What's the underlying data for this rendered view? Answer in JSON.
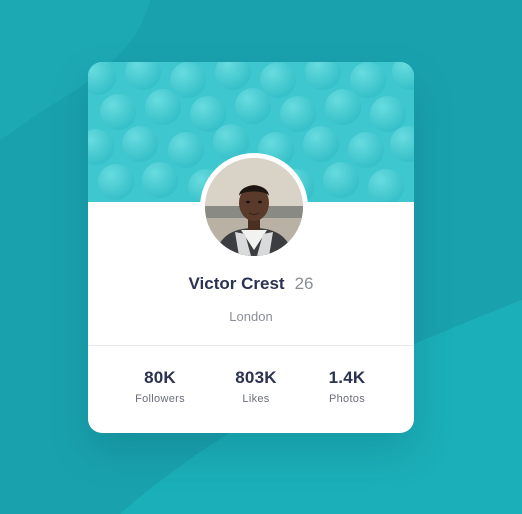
{
  "profile": {
    "name": "Victor Crest",
    "age": "26",
    "location": "London"
  },
  "stats": [
    {
      "value": "80K",
      "label": "Followers"
    },
    {
      "value": "803K",
      "label": "Likes"
    },
    {
      "value": "1.4K",
      "label": "Photos"
    }
  ],
  "colors": {
    "background": "#19a2ae",
    "banner": "#3fc9d0",
    "text_dark": "#2b3252",
    "text_muted": "#8a8e99",
    "card": "#ffffff"
  }
}
